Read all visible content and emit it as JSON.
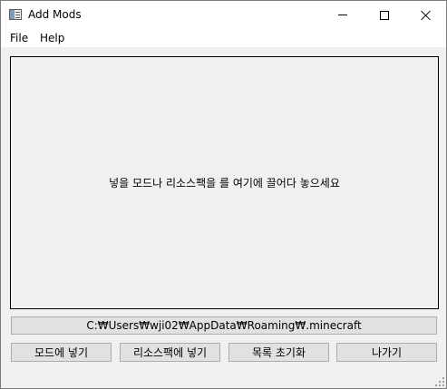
{
  "window": {
    "title": "Add Mods",
    "icon": "app-window-icon",
    "controls": {
      "minimize": "minimize-icon",
      "maximize": "maximize-icon",
      "close": "close-icon"
    }
  },
  "menu": {
    "items": [
      {
        "label": "File"
      },
      {
        "label": "Help"
      }
    ]
  },
  "main": {
    "drop_text": "넣을 모드나 리소스팩을 를 여기에 끌어다 놓으세요",
    "path": "C:₩Users₩wji02₩AppData₩Roaming₩.minecraft"
  },
  "buttons": {
    "add_mod": "모드에 넣기",
    "add_resourcepack": "리소스팩에 넣기",
    "reset_list": "목록 초기화",
    "exit": "나가기"
  }
}
